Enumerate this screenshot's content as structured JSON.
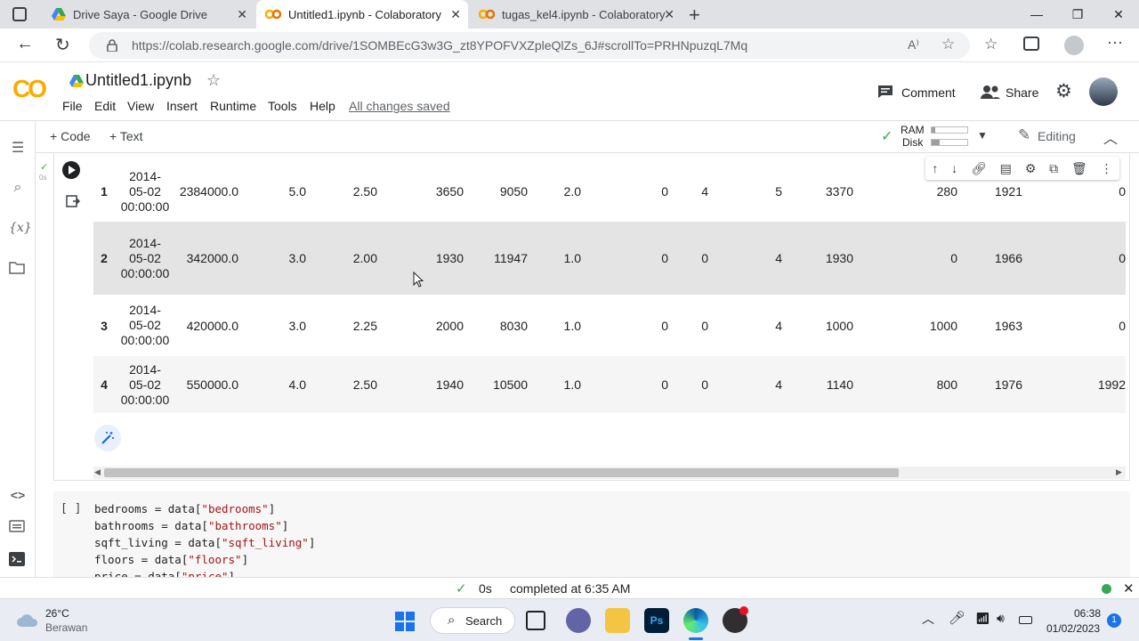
{
  "browser": {
    "tabs": [
      {
        "title": "Drive Saya - Google Drive",
        "icon": "google-drive-icon"
      },
      {
        "title": "Untitled1.ipynb - Colaboratory",
        "icon": "colab-icon"
      },
      {
        "title": "tugas_kel4.ipynb - Colaboratory",
        "icon": "colab-icon"
      }
    ],
    "url": "https://colab.research.google.com/drive/1SOMBEcG3w3G_zt8YPOFVXZpleQlZs_6J#scrollTo=PRHNpuzqL7Mq"
  },
  "colab": {
    "logo_text": "CO",
    "notebook_title": "Untitled1.ipynb",
    "menu": [
      "File",
      "Edit",
      "View",
      "Insert",
      "Runtime",
      "Tools",
      "Help"
    ],
    "saved_status": "All changes saved",
    "comment_label": "Comment",
    "share_label": "Share",
    "toolbar": {
      "add_code": "Code",
      "add_text": "Text",
      "ram_label": "RAM",
      "disk_label": "Disk",
      "editing_label": "Editing"
    },
    "cell_exec_time": "0s"
  },
  "table": {
    "rows": [
      {
        "idx": "1",
        "date1": "2014-",
        "date2": "05-02",
        "date3": "00:00:00",
        "cells": [
          "2384000.0",
          "5.0",
          "2.50",
          "3650",
          "9050",
          "2.0",
          "0",
          "4",
          "5",
          "3370",
          "280",
          "1921",
          "0"
        ]
      },
      {
        "idx": "2",
        "date1": "2014-",
        "date2": "05-02",
        "date3": "00:00:00",
        "cells": [
          "342000.0",
          "3.0",
          "2.00",
          "1930",
          "11947",
          "1.0",
          "0",
          "0",
          "4",
          "1930",
          "0",
          "1966",
          "0"
        ]
      },
      {
        "idx": "3",
        "date1": "2014-",
        "date2": "05-02",
        "date3": "00:00:00",
        "cells": [
          "420000.0",
          "3.0",
          "2.25",
          "2000",
          "8030",
          "1.0",
          "0",
          "0",
          "4",
          "1000",
          "1000",
          "1963",
          "0"
        ]
      },
      {
        "idx": "4",
        "date1": "2014-",
        "date2": "05-02",
        "date3": "00:00:00",
        "cells": [
          "550000.0",
          "4.0",
          "2.50",
          "1940",
          "10500",
          "1.0",
          "0",
          "0",
          "4",
          "1140",
          "800",
          "1976",
          "1992"
        ]
      }
    ]
  },
  "code_cell": {
    "bracket": "[ ]",
    "lines": [
      {
        "pre": "bedrooms = data[",
        "str": "\"bedrooms\"",
        "post": "]"
      },
      {
        "pre": "bathrooms = data[",
        "str": "\"bathrooms\"",
        "post": "]"
      },
      {
        "pre": "sqft_living = data[",
        "str": "\"sqft_living\"",
        "post": "]"
      },
      {
        "pre": "floors = data[",
        "str": "\"floors\"",
        "post": "]"
      },
      {
        "pre": "price = data[",
        "str": "\"price\"",
        "post": "]"
      }
    ]
  },
  "status": {
    "elapsed": "0s",
    "message": "completed at 6:35 AM"
  },
  "taskbar": {
    "weather_temp": "26°C",
    "weather_desc": "Berawan",
    "search_label": "Search",
    "time": "06:38",
    "date": "01/02/2023",
    "notification_count": "1"
  },
  "colors": {
    "colab_orange": "#f9ab00",
    "accent_green": "#34a853",
    "string_red": "#a31515"
  }
}
